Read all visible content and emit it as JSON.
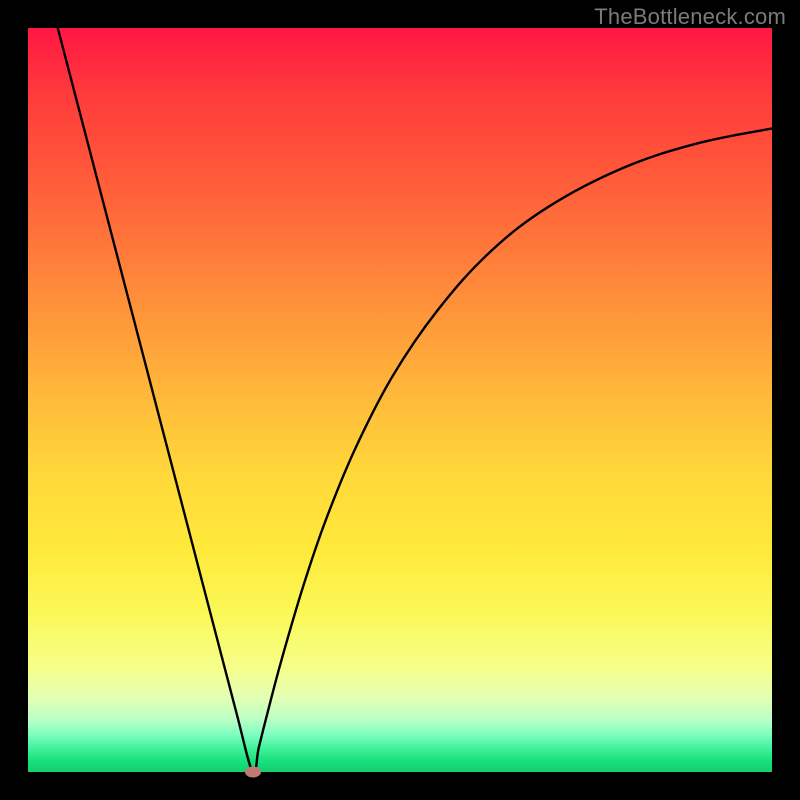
{
  "attribution": "TheBottleneck.com",
  "colors": {
    "frame": "#000000",
    "gradient_top": "#ff1744",
    "gradient_bottom": "#13ce6e",
    "curve_stroke": "#000000",
    "dot_fill": "#c17a72"
  },
  "chart_data": {
    "type": "line",
    "title": "",
    "xlabel": "",
    "ylabel": "",
    "xlim": [
      0,
      100
    ],
    "ylim": [
      0,
      100
    ],
    "legend": false,
    "grid": false,
    "series": [
      {
        "name": "bottleneck-curve",
        "x": [
          4,
          7,
          10,
          13,
          16,
          19,
          22,
          25,
          28,
          30.2,
          31,
          32,
          34,
          37,
          40,
          44,
          49,
          55,
          62,
          70,
          80,
          90,
          100
        ],
        "y": [
          100,
          88.5,
          77,
          65.5,
          54,
          42.5,
          31,
          19.5,
          8,
          0,
          3.2,
          7.2,
          14.8,
          25,
          33.8,
          43.5,
          53.2,
          62,
          69.8,
          76,
          81.2,
          84.5,
          86.5
        ]
      }
    ],
    "marker": {
      "x": 30.2,
      "y": 0,
      "shape": "ellipse"
    },
    "background_gradient": {
      "orientation": "vertical",
      "stops": [
        {
          "pos": 0.0,
          "color": "#ff1744"
        },
        {
          "pos": 0.5,
          "color": "#ffbb3a"
        },
        {
          "pos": 0.8,
          "color": "#faf959"
        },
        {
          "pos": 1.0,
          "color": "#13ce6e"
        }
      ]
    }
  }
}
